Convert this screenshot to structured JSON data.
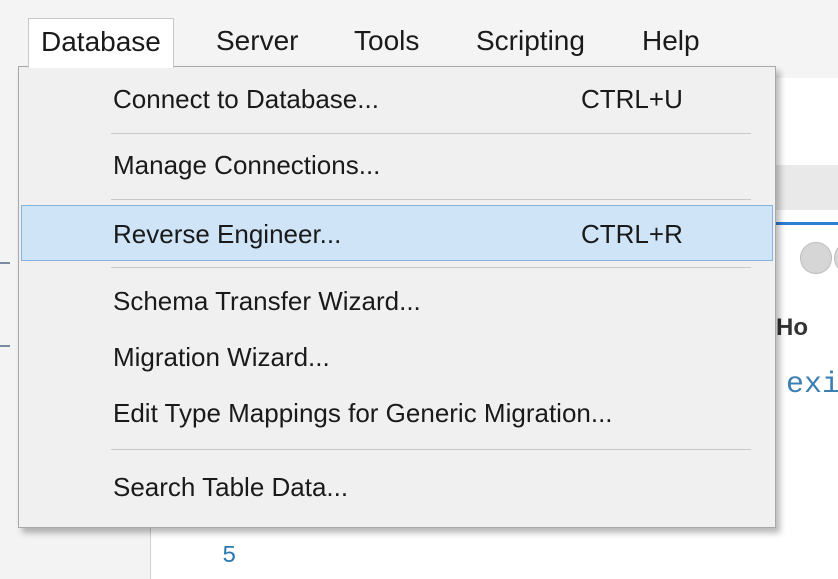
{
  "menubar": {
    "items": [
      {
        "label": "Database"
      },
      {
        "label": "Server"
      },
      {
        "label": "Tools"
      },
      {
        "label": "Scripting"
      },
      {
        "label": "Help"
      }
    ]
  },
  "dropdown": {
    "items": [
      {
        "label": "Connect to Database...",
        "shortcut": "CTRL+U"
      },
      {
        "label": "Manage Connections...",
        "shortcut": ""
      },
      {
        "label": "Reverse Engineer...",
        "shortcut": "CTRL+R",
        "highlighted": true
      },
      {
        "label": "Schema Transfer Wizard...",
        "shortcut": ""
      },
      {
        "label": "Migration Wizard...",
        "shortcut": ""
      },
      {
        "label": "Edit Type Mappings for Generic Migration...",
        "shortcut": ""
      },
      {
        "label": "Search Table Data...",
        "shortcut": ""
      }
    ]
  },
  "background": {
    "partial_heading": "Ho",
    "partial_code": "exi",
    "line_number": "5"
  },
  "colors": {
    "highlight_bg": "#cfe4f7",
    "highlight_border": "#84b3e0",
    "accent_blue": "#2c7fd0"
  }
}
